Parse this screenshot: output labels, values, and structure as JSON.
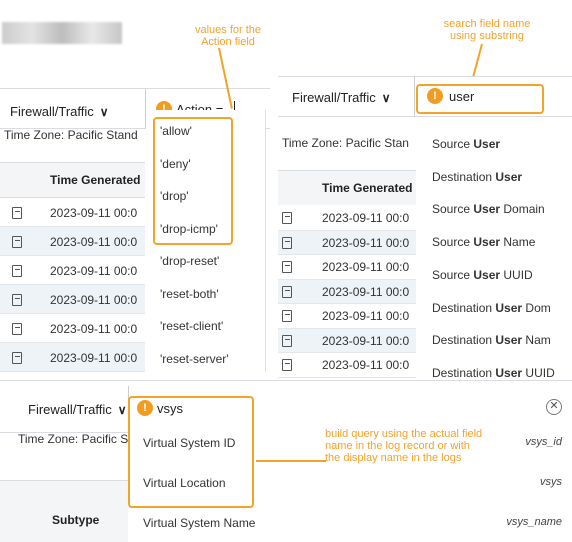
{
  "top_left": {
    "dropdown": "Firewall/Traffic",
    "query_label": "Action =",
    "timezone": "Time Zone: Pacific Stand",
    "column_header": "Time Generated",
    "rows": [
      "2023-09-11 00:0",
      "2023-09-11 00:0",
      "2023-09-11 00:0",
      "2023-09-11 00:0",
      "2023-09-11 00:0",
      "2023-09-11 00:0"
    ],
    "last_row": "2023-09-11 00",
    "values": [
      "'allow'",
      "'deny'",
      "'drop'",
      "'drop-icmp'",
      "'drop-reset'",
      "'reset-both'",
      "'reset-client'",
      "'reset-server'"
    ],
    "annotation": "values for the Action field"
  },
  "top_right": {
    "dropdown": "Firewall/Traffic",
    "query_text": "user",
    "timezone": "Time Zone: Pacific Stan",
    "column_header": "Time Generated",
    "rows": [
      "2023-09-11 00:0",
      "2023-09-11 00:0",
      "2023-09-11 00:0",
      "2023-09-11 00:0",
      "2023-09-11 00:0",
      "2023-09-11 00:0",
      "2023-09-11 00:0"
    ],
    "suggestions": [
      {
        "pre": "Source ",
        "bold": "User",
        "post": ""
      },
      {
        "pre": "Destination ",
        "bold": "User",
        "post": ""
      },
      {
        "pre": "Source ",
        "bold": "User",
        "post": " Domain"
      },
      {
        "pre": "Source ",
        "bold": "User",
        "post": " Name"
      },
      {
        "pre": "Source ",
        "bold": "User",
        "post": " UUID"
      },
      {
        "pre": "Destination ",
        "bold": "User",
        "post": " Dom"
      },
      {
        "pre": "Destination ",
        "bold": "User",
        "post": " Nam"
      },
      {
        "pre": "Destination ",
        "bold": "User",
        "post": " UUID"
      }
    ],
    "annotation": "search field name using substring"
  },
  "bottom": {
    "dropdown": "Firewall/Traffic",
    "query_text": "vsys",
    "timezone": "Time Zone: Pacific Stan",
    "column_header": "Subtype",
    "suggestions": [
      {
        "label": "Virtual System ID",
        "field": "vsys_id"
      },
      {
        "label": "Virtual Location",
        "field": "vsys"
      },
      {
        "label": "Virtual System Name",
        "field": "vsys_name"
      }
    ],
    "annotation": "build query using the actual field name in the log record or with the display name in the logs"
  },
  "colors": {
    "accent": "#f3a32a",
    "warning": "#f29d1f",
    "row_alt": "#edf3f7"
  }
}
